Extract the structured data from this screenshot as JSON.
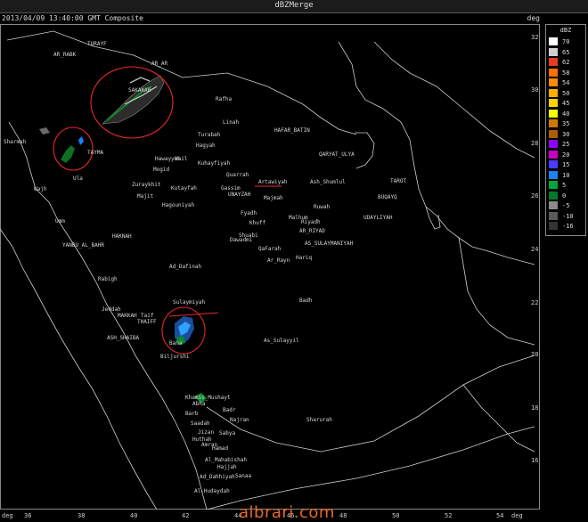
{
  "window": {
    "title": "dBZMerge"
  },
  "header": {
    "timestamp": "2013/04/09 13:40:00 GMT Composite",
    "deg_label": "deg"
  },
  "legend": {
    "unit": "dBZ",
    "levels": [
      {
        "value": "70",
        "color": "#ffffff"
      },
      {
        "value": "65",
        "color": "#d0d0d0"
      },
      {
        "value": "62",
        "color": "#e83b20"
      },
      {
        "value": "58",
        "color": "#ff6f00"
      },
      {
        "value": "54",
        "color": "#ff8a00"
      },
      {
        "value": "50",
        "color": "#ffae00"
      },
      {
        "value": "45",
        "color": "#ffd400"
      },
      {
        "value": "40",
        "color": "#f5ff00"
      },
      {
        "value": "35",
        "color": "#d07800"
      },
      {
        "value": "30",
        "color": "#aa6000"
      },
      {
        "value": "25",
        "color": "#9100ff"
      },
      {
        "value": "20",
        "color": "#c800c8"
      },
      {
        "value": "15",
        "color": "#4a3cff"
      },
      {
        "value": "10",
        "color": "#1b82ff"
      },
      {
        "value": "5",
        "color": "#00a83a"
      },
      {
        "value": "0",
        "color": "#007a2a"
      },
      {
        "value": "-5",
        "color": "#8a8a8a"
      },
      {
        "value": "-10",
        "color": "#5a5a5a"
      },
      {
        "value": "-16",
        "color": "#333333"
      }
    ]
  },
  "axes": {
    "x_label_left": "deg",
    "x_label_right": "deg",
    "x_ticks": [
      "36",
      "38",
      "40",
      "42",
      "44",
      "46",
      "48",
      "50",
      "52",
      "54"
    ],
    "y_ticks": [
      "32",
      "30",
      "28",
      "26",
      "24",
      "22",
      "20",
      "18",
      "16"
    ]
  },
  "cities": [
    {
      "name": "TURAYF"
    },
    {
      "name": "AR_RABK"
    },
    {
      "name": "AR_AR"
    },
    {
      "name": "Rafha"
    },
    {
      "name": "SAKAKAH"
    },
    {
      "name": "Linah"
    },
    {
      "name": "HAFAR_BATIN"
    },
    {
      "name": "Turabah"
    },
    {
      "name": "Hagyah"
    },
    {
      "name": "QARYAT_ULYA"
    },
    {
      "name": "Sharmah"
    },
    {
      "name": "TAYMA"
    },
    {
      "name": "Hawayyah"
    },
    {
      "name": "Hail"
    },
    {
      "name": "Kuhayfiyah"
    },
    {
      "name": "Ula"
    },
    {
      "name": "Mogid"
    },
    {
      "name": "Quarrah"
    },
    {
      "name": "Artawiyah"
    },
    {
      "name": "Ash_Shumlul"
    },
    {
      "name": "TAROT"
    },
    {
      "name": "Wajh"
    },
    {
      "name": "Zuraykhit"
    },
    {
      "name": "Kutayfah"
    },
    {
      "name": "Gassim"
    },
    {
      "name": "UNAYZAH"
    },
    {
      "name": "Majmah"
    },
    {
      "name": "BUQAYQ"
    },
    {
      "name": "Majit"
    },
    {
      "name": "Hagouniyah"
    },
    {
      "name": "Ruwah"
    },
    {
      "name": "Fyadh"
    },
    {
      "name": "Khuff"
    },
    {
      "name": "Malhum"
    },
    {
      "name": "Riyadh"
    },
    {
      "name": "UDAYLIYAH"
    },
    {
      "name": "Umm"
    },
    {
      "name": "Shuabi"
    },
    {
      "name": "Dawadmi"
    },
    {
      "name": "AR_RIYAD"
    },
    {
      "name": "YANBU_AL_BAHR"
    },
    {
      "name": "HAKNAH"
    },
    {
      "name": "QaFarah"
    },
    {
      "name": "AS_SULAYMANIYAH"
    },
    {
      "name": "Ar_Rayn"
    },
    {
      "name": "Hariq"
    },
    {
      "name": "Ad_Dafinah"
    },
    {
      "name": "Rabigh"
    },
    {
      "name": "Sulaymiyah"
    },
    {
      "name": "Badh"
    },
    {
      "name": "Jeddah"
    },
    {
      "name": "MAKKAH"
    },
    {
      "name": "Taif"
    },
    {
      "name": "THAIFF"
    },
    {
      "name": "ASH_SHAIBA"
    },
    {
      "name": "Baha"
    },
    {
      "name": "As_Sulayyil"
    },
    {
      "name": "Biljurshi"
    },
    {
      "name": "Khamis_Mushayt"
    },
    {
      "name": "Abha"
    },
    {
      "name": "Badr"
    },
    {
      "name": "Barb"
    },
    {
      "name": "Najran"
    },
    {
      "name": "Saadah"
    },
    {
      "name": "Sharurah"
    },
    {
      "name": "Jizan"
    },
    {
      "name": "Sabya"
    },
    {
      "name": "Huthah"
    },
    {
      "name": "Amran"
    },
    {
      "name": "Hamad"
    },
    {
      "name": "Al-Hudaydah"
    },
    {
      "name": "Al_Mahabishah"
    },
    {
      "name": "Hajjah"
    },
    {
      "name": "Ad_Dahhiyah"
    },
    {
      "name": "Sanaa"
    }
  ],
  "watermark": {
    "text": "albrari.com"
  }
}
